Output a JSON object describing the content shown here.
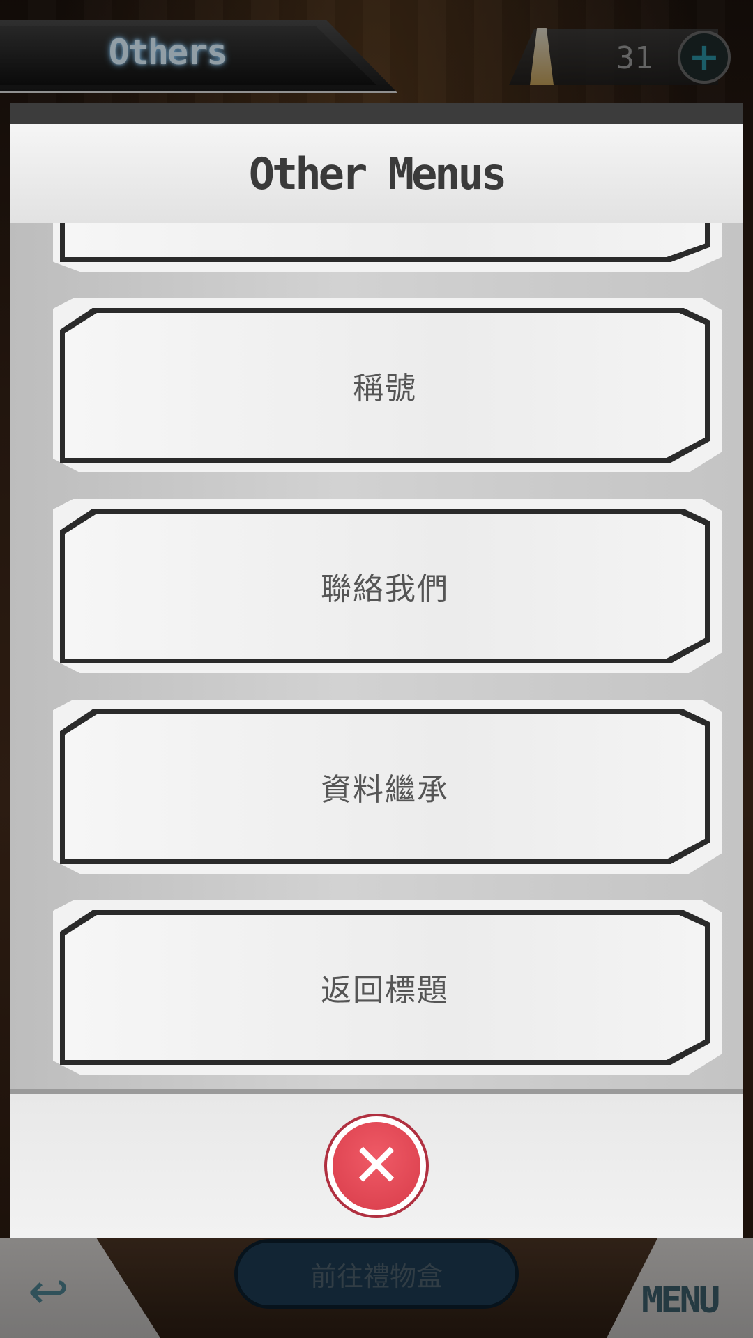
{
  "header": {
    "title": "Others",
    "currency_value": "31",
    "add_label": "+"
  },
  "modal": {
    "title": "Other Menus",
    "items": [
      {
        "label": "稱號"
      },
      {
        "label": "聯絡我們"
      },
      {
        "label": "資料繼承"
      },
      {
        "label": "返回標題"
      }
    ],
    "close_label": "✕"
  },
  "bottom_nav": {
    "back_label": "↩",
    "gift_label": "前往禮物盒",
    "menu_label": "MENU"
  }
}
